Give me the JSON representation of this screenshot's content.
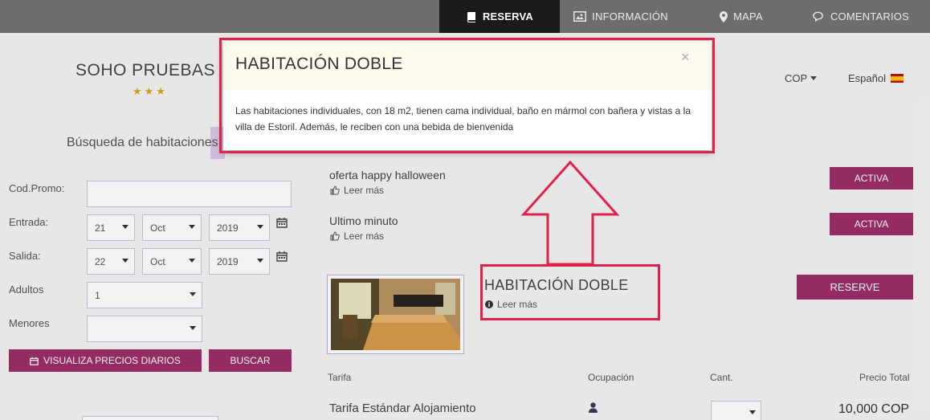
{
  "nav": {
    "items": [
      {
        "label": "RESERVA",
        "icon": "book-icon",
        "active": true
      },
      {
        "label": "INFORMACIÓN",
        "icon": "image-icon",
        "active": false
      },
      {
        "label": "MAPA",
        "icon": "map-marker-icon",
        "active": false
      },
      {
        "label": "COMENTARIOS",
        "icon": "comments-icon",
        "active": false
      }
    ]
  },
  "hotel": {
    "name": "SOHO PRUEBAS",
    "stars": "★★★"
  },
  "search": {
    "title": "Búsqueda de habitaciones",
    "promo_label": "Cod.Promo:",
    "promo_value": "",
    "checkin_label": "Entrada:",
    "checkin_day": "21",
    "checkin_month": "Oct",
    "checkin_year": "2019",
    "checkout_label": "Salida:",
    "checkout_day": "22",
    "checkout_month": "Oct",
    "checkout_year": "2019",
    "adults_label": "Adultos",
    "adults_value": "1",
    "children_label": "Menores",
    "children_value": "",
    "daily_prices_button": "VISUALIZA PRECIOS DIARIOS",
    "search_button": "BUSCAR"
  },
  "header_right": {
    "currency": "COP",
    "language": "Español"
  },
  "offers": [
    {
      "title": "oferta happy halloween",
      "readmore": "Leer más",
      "button": "ACTIVA"
    },
    {
      "title": "Ultimo minuto",
      "readmore": "Leer más",
      "button": "ACTIVA"
    }
  ],
  "room": {
    "title": "HABITACIÓN DOBLE",
    "readmore": "Leer más",
    "button": "RESERVE"
  },
  "rate_table": {
    "headers": {
      "tarifa": "Tarifa",
      "ocupacion": "Ocupación",
      "cant": "Cant.",
      "precio": "Precio Total"
    },
    "row": {
      "name": "Tarifa Estándar Alojamiento",
      "price": "10,000 COP"
    }
  },
  "modal": {
    "title": "HABITACIÓN DOBLE",
    "close": "×",
    "body": "Las habitaciones individuales, con 18 m2, tienen cama individual, baño en mármol con bañera y vistas a la villa de Estoril. Además, le reciben con una bebida de bienvenida"
  },
  "colors": {
    "accent": "#9c2f67",
    "annotation": "#e0224a",
    "nav_bg": "#6d6d6d"
  }
}
